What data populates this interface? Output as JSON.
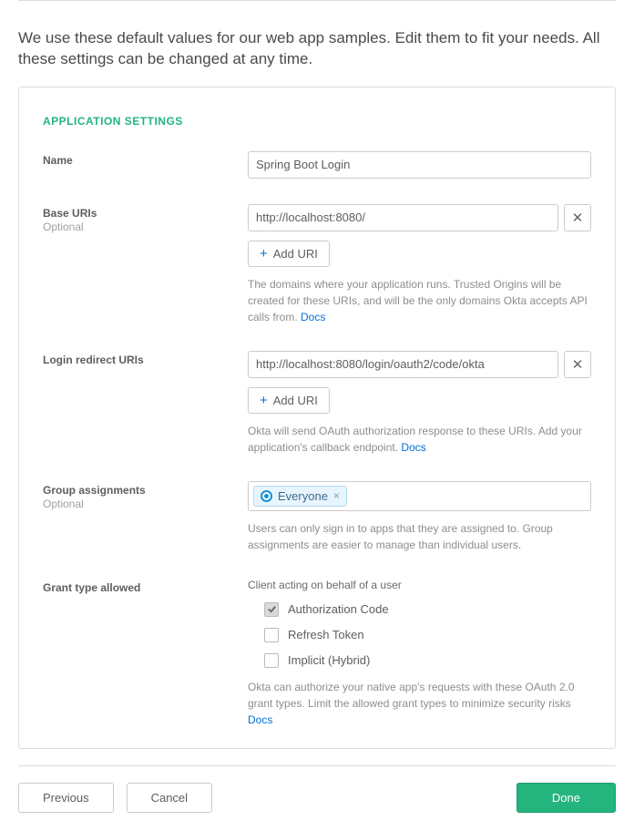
{
  "header": {
    "intro": "We use these default values for our web app samples. Edit them to fit your needs. All these settings can be changed at any time."
  },
  "panel": {
    "title": "APPLICATION SETTINGS",
    "name": {
      "label": "Name",
      "value": "Spring Boot Login"
    },
    "baseUris": {
      "label": "Base URIs",
      "sublabel": "Optional",
      "value": "http://localhost:8080/",
      "addLabel": "Add URI",
      "helper": "The domains where your application runs. Trusted Origins will be created for these URIs, and will be the only domains Okta accepts API calls from. ",
      "docsLabel": "Docs"
    },
    "loginRedirect": {
      "label": "Login redirect URIs",
      "value": "http://localhost:8080/login/oauth2/code/okta",
      "addLabel": "Add URI",
      "helper": "Okta will send OAuth authorization response to these URIs. Add your application's callback endpoint. ",
      "docsLabel": "Docs"
    },
    "groups": {
      "label": "Group assignments",
      "sublabel": "Optional",
      "tag": "Everyone",
      "helper": "Users can only sign in to apps that they are assigned to. Group assignments are easier to manage than individual users."
    },
    "grantType": {
      "label": "Grant type allowed",
      "subheading": "Client acting on behalf of a user",
      "options": [
        {
          "label": "Authorization Code",
          "checked": true
        },
        {
          "label": "Refresh Token",
          "checked": false
        },
        {
          "label": "Implicit (Hybrid)",
          "checked": false
        }
      ],
      "helper": "Okta can authorize your native app's requests with these OAuth 2.0 grant types. Limit the allowed grant types to minimize security risks ",
      "docsLabel": "Docs"
    }
  },
  "footer": {
    "previous": "Previous",
    "cancel": "Cancel",
    "done": "Done"
  }
}
